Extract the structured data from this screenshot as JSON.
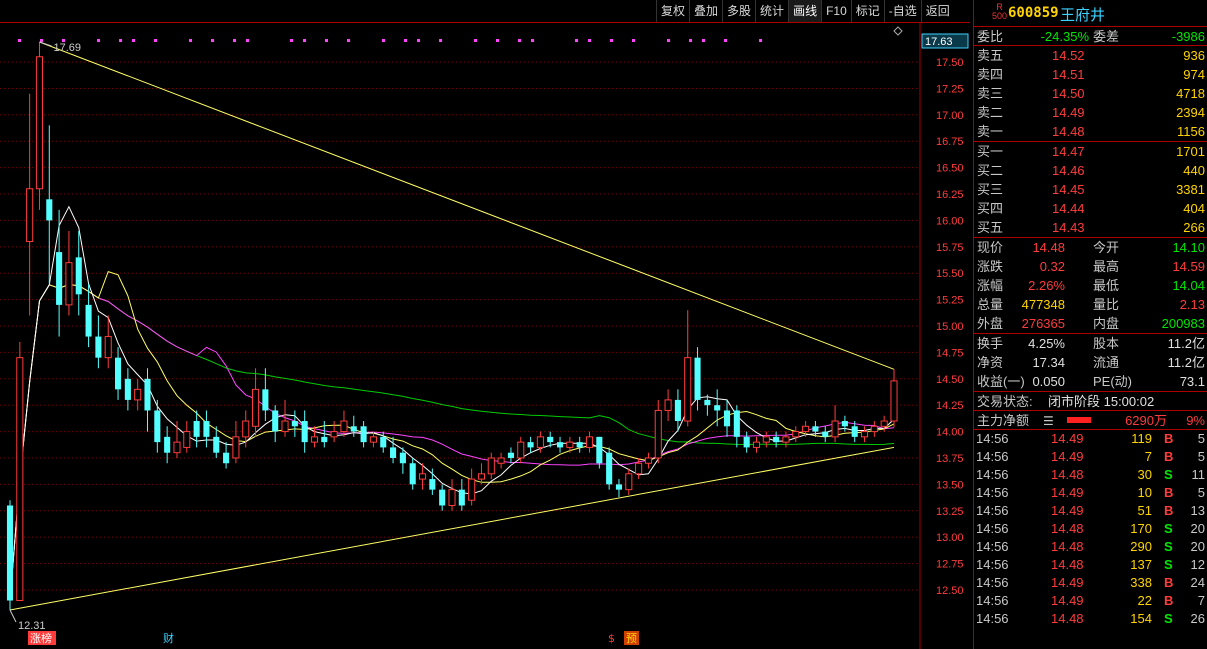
{
  "toolbar": {
    "items": [
      "复权",
      "叠加",
      "多股",
      "统计",
      "画线",
      "F10",
      "标记",
      "-自选",
      "返回"
    ]
  },
  "chart": {
    "y_ticks": [
      "17.50",
      "17.25",
      "17.00",
      "16.75",
      "16.50",
      "16.25",
      "16.00",
      "15.75",
      "15.50",
      "15.25",
      "15.00",
      "14.75",
      "14.50",
      "14.25",
      "14.00",
      "13.75",
      "13.50",
      "13.25",
      "13.00",
      "12.75",
      "12.50"
    ],
    "current_price_tag": "17.63",
    "high_label": "17.69",
    "low_label": "12.31",
    "markers": [
      "涨榜",
      "财",
      "$",
      "预"
    ],
    "colors": {
      "up": "#ff3c3c",
      "down": "#54ffff",
      "ma5": "#ffffff",
      "ma10": "#ffff66",
      "ma20": "#ff44ff",
      "ma60": "#00cc00",
      "trendline": "#ffff66",
      "grid": "#7a0000"
    }
  },
  "chart_data": {
    "type": "candlestick",
    "ylim": [
      12.31,
      17.69
    ],
    "candles": [
      [
        13.3,
        12.4,
        13.35,
        12.31
      ],
      [
        12.4,
        14.7,
        14.85,
        12.95
      ],
      [
        15.8,
        16.3,
        17.2,
        15.1
      ],
      [
        16.3,
        17.55,
        17.69,
        16.1
      ],
      [
        16.2,
        16.0,
        16.9,
        15.4
      ],
      [
        15.7,
        15.2,
        16.1,
        14.9
      ],
      [
        15.2,
        15.6,
        15.9,
        15.1
      ],
      [
        15.65,
        15.3,
        15.9,
        15.1
      ],
      [
        15.2,
        14.9,
        15.4,
        14.8
      ],
      [
        14.9,
        14.7,
        15.1,
        14.6
      ],
      [
        14.7,
        14.9,
        15.1,
        14.6
      ],
      [
        14.7,
        14.4,
        14.8,
        14.3
      ],
      [
        14.5,
        14.3,
        14.6,
        14.2
      ],
      [
        14.3,
        14.4,
        14.5,
        14.2
      ],
      [
        14.5,
        14.2,
        14.6,
        14.0
      ],
      [
        14.2,
        13.9,
        14.3,
        13.8
      ],
      [
        13.95,
        13.8,
        14.05,
        13.7
      ],
      [
        13.8,
        13.9,
        14.1,
        13.75
      ],
      [
        13.85,
        14.0,
        14.1,
        13.8
      ],
      [
        14.1,
        13.95,
        14.2,
        13.85
      ],
      [
        14.1,
        13.95,
        14.2,
        13.85
      ],
      [
        13.95,
        13.8,
        14.05,
        13.75
      ],
      [
        13.8,
        13.7,
        13.9,
        13.65
      ],
      [
        13.75,
        13.95,
        14.1,
        13.7
      ],
      [
        13.95,
        14.1,
        14.2,
        13.85
      ],
      [
        14.05,
        14.4,
        14.6,
        13.95
      ],
      [
        14.4,
        14.2,
        14.6,
        14.1
      ],
      [
        14.2,
        14.0,
        14.25,
        13.9
      ],
      [
        14.0,
        14.1,
        14.3,
        13.95
      ],
      [
        14.1,
        14.05,
        14.2,
        13.95
      ],
      [
        14.1,
        13.9,
        14.2,
        13.8
      ],
      [
        13.9,
        13.95,
        14.05,
        13.85
      ],
      [
        13.95,
        13.9,
        14.1,
        13.85
      ],
      [
        13.95,
        14.0,
        14.1,
        13.9
      ],
      [
        14.0,
        14.1,
        14.2,
        13.95
      ],
      [
        14.05,
        14.0,
        14.15,
        13.95
      ],
      [
        14.05,
        13.9,
        14.1,
        13.85
      ],
      [
        13.9,
        13.95,
        14.0,
        13.85
      ],
      [
        13.95,
        13.85,
        14.0,
        13.8
      ],
      [
        13.85,
        13.75,
        13.95,
        13.7
      ],
      [
        13.8,
        13.7,
        13.85,
        13.6
      ],
      [
        13.7,
        13.5,
        13.75,
        13.45
      ],
      [
        13.55,
        13.6,
        13.7,
        13.45
      ],
      [
        13.55,
        13.45,
        13.65,
        13.4
      ],
      [
        13.45,
        13.3,
        13.5,
        13.25
      ],
      [
        13.3,
        13.45,
        13.55,
        13.25
      ],
      [
        13.45,
        13.3,
        13.55,
        13.25
      ],
      [
        13.35,
        13.55,
        13.65,
        13.3
      ],
      [
        13.55,
        13.6,
        13.7,
        13.5
      ],
      [
        13.6,
        13.75,
        13.8,
        13.55
      ],
      [
        13.7,
        13.75,
        13.8,
        13.65
      ],
      [
        13.8,
        13.75,
        13.85,
        13.7
      ],
      [
        13.75,
        13.9,
        13.95,
        13.7
      ],
      [
        13.9,
        13.85,
        13.95,
        13.8
      ],
      [
        13.85,
        13.95,
        14.0,
        13.8
      ],
      [
        13.95,
        13.9,
        14.0,
        13.85
      ],
      [
        13.9,
        13.85,
        13.95,
        13.8
      ],
      [
        13.85,
        13.9,
        13.95,
        13.8
      ],
      [
        13.9,
        13.85,
        13.95,
        13.8
      ],
      [
        13.85,
        13.95,
        14.0,
        13.8
      ],
      [
        13.95,
        13.7,
        13.95,
        13.65
      ],
      [
        13.8,
        13.5,
        13.85,
        13.45
      ],
      [
        13.5,
        13.45,
        13.55,
        13.38
      ],
      [
        13.45,
        13.6,
        13.65,
        13.4
      ],
      [
        13.6,
        13.7,
        13.75,
        13.55
      ],
      [
        13.7,
        13.75,
        13.8,
        13.65
      ],
      [
        13.75,
        14.2,
        14.3,
        13.7
      ],
      [
        14.2,
        14.3,
        14.4,
        14.1
      ],
      [
        14.3,
        14.1,
        14.4,
        14.0
      ],
      [
        14.1,
        14.7,
        15.15,
        14.05
      ],
      [
        14.7,
        14.3,
        14.8,
        14.2
      ],
      [
        14.3,
        14.25,
        14.35,
        14.15
      ],
      [
        14.25,
        14.2,
        14.4,
        14.05
      ],
      [
        14.2,
        14.05,
        14.3,
        13.95
      ],
      [
        14.2,
        13.95,
        14.25,
        13.85
      ],
      [
        13.95,
        13.85,
        14.0,
        13.8
      ],
      [
        13.85,
        13.9,
        13.95,
        13.8
      ],
      [
        13.9,
        13.95,
        14.0,
        13.85
      ],
      [
        13.95,
        13.9,
        14.0,
        13.85
      ],
      [
        13.9,
        13.95,
        14.0,
        13.85
      ],
      [
        13.95,
        14.0,
        14.05,
        13.9
      ],
      [
        14.0,
        14.05,
        14.1,
        13.95
      ],
      [
        14.05,
        14.0,
        14.1,
        13.95
      ],
      [
        14.0,
        13.95,
        14.05,
        13.9
      ],
      [
        13.95,
        14.1,
        14.25,
        13.9
      ],
      [
        14.1,
        14.05,
        14.15,
        14.0
      ],
      [
        14.05,
        13.95,
        14.1,
        13.9
      ],
      [
        13.95,
        14.0,
        14.05,
        13.9
      ],
      [
        14.0,
        14.05,
        14.1,
        13.95
      ],
      [
        14.05,
        14.1,
        14.15,
        14.0
      ],
      [
        14.1,
        14.48,
        14.59,
        14.04
      ]
    ],
    "trendline_upper": [
      [
        3,
        17.69
      ],
      [
        90,
        14.59
      ]
    ],
    "trendline_lower": [
      [
        0,
        12.31
      ],
      [
        90,
        13.85
      ]
    ]
  },
  "quote": {
    "r_label": "R",
    "r_num": "500",
    "code": "600859",
    "name": "王府井",
    "weibi_label": "委比",
    "weibi": "-24.35%",
    "weicha_label": "委差",
    "weicha": "-3986",
    "asks": [
      {
        "label": "卖五",
        "price": "14.52",
        "vol": "936"
      },
      {
        "label": "卖四",
        "price": "14.51",
        "vol": "974"
      },
      {
        "label": "卖三",
        "price": "14.50",
        "vol": "4718"
      },
      {
        "label": "卖二",
        "price": "14.49",
        "vol": "2394"
      },
      {
        "label": "卖一",
        "price": "14.48",
        "vol": "1156"
      }
    ],
    "bids": [
      {
        "label": "买一",
        "price": "14.47",
        "vol": "1701"
      },
      {
        "label": "买二",
        "price": "14.46",
        "vol": "440"
      },
      {
        "label": "买三",
        "price": "14.45",
        "vol": "3381"
      },
      {
        "label": "买四",
        "price": "14.44",
        "vol": "404"
      },
      {
        "label": "买五",
        "price": "14.43",
        "vol": "266"
      }
    ],
    "stats1": [
      {
        "l1": "现价",
        "v1": "14.48",
        "c1": "red",
        "l2": "今开",
        "v2": "14.10",
        "c2": "green"
      },
      {
        "l1": "涨跌",
        "v1": "0.32",
        "c1": "red",
        "l2": "最高",
        "v2": "14.59",
        "c2": "red"
      },
      {
        "l1": "涨幅",
        "v1": "2.26%",
        "c1": "red",
        "l2": "最低",
        "v2": "14.04",
        "c2": "green"
      },
      {
        "l1": "总量",
        "v1": "477348",
        "c1": "yellow",
        "l2": "量比",
        "v2": "2.13",
        "c2": "red"
      },
      {
        "l1": "外盘",
        "v1": "276365",
        "c1": "red",
        "l2": "内盘",
        "v2": "200983",
        "c2": "green"
      }
    ],
    "stats2": [
      {
        "l1": "换手",
        "v1": "4.25%",
        "l2": "股本",
        "v2": "11.2亿"
      },
      {
        "l1": "净资",
        "v1": "17.34",
        "l2": "流通",
        "v2": "11.2亿"
      },
      {
        "l1": "收益(一)",
        "v1": "0.050",
        "l2": "PE(动)",
        "v2": "73.1"
      }
    ],
    "status_label": "交易状态:",
    "status_value": "闭市阶段 15:00:02",
    "main_label": "主力净额",
    "main_value": "6290万",
    "main_pct": "9%",
    "ticks": [
      {
        "time": "14:56",
        "price": "14.49",
        "vol": "119",
        "side": "B",
        "num": "5"
      },
      {
        "time": "14:56",
        "price": "14.49",
        "vol": "7",
        "side": "B",
        "num": "5"
      },
      {
        "time": "14:56",
        "price": "14.48",
        "vol": "30",
        "side": "S",
        "num": "11"
      },
      {
        "time": "14:56",
        "price": "14.49",
        "vol": "10",
        "side": "B",
        "num": "5"
      },
      {
        "time": "14:56",
        "price": "14.49",
        "vol": "51",
        "side": "B",
        "num": "13"
      },
      {
        "time": "14:56",
        "price": "14.48",
        "vol": "170",
        "side": "S",
        "num": "20"
      },
      {
        "time": "14:56",
        "price": "14.48",
        "vol": "290",
        "side": "S",
        "num": "20"
      },
      {
        "time": "14:56",
        "price": "14.48",
        "vol": "137",
        "side": "S",
        "num": "12"
      },
      {
        "time": "14:56",
        "price": "14.49",
        "vol": "338",
        "side": "B",
        "num": "24"
      },
      {
        "time": "14:56",
        "price": "14.49",
        "vol": "22",
        "side": "B",
        "num": "7"
      },
      {
        "time": "14:56",
        "price": "14.48",
        "vol": "154",
        "side": "S",
        "num": "26"
      }
    ]
  }
}
